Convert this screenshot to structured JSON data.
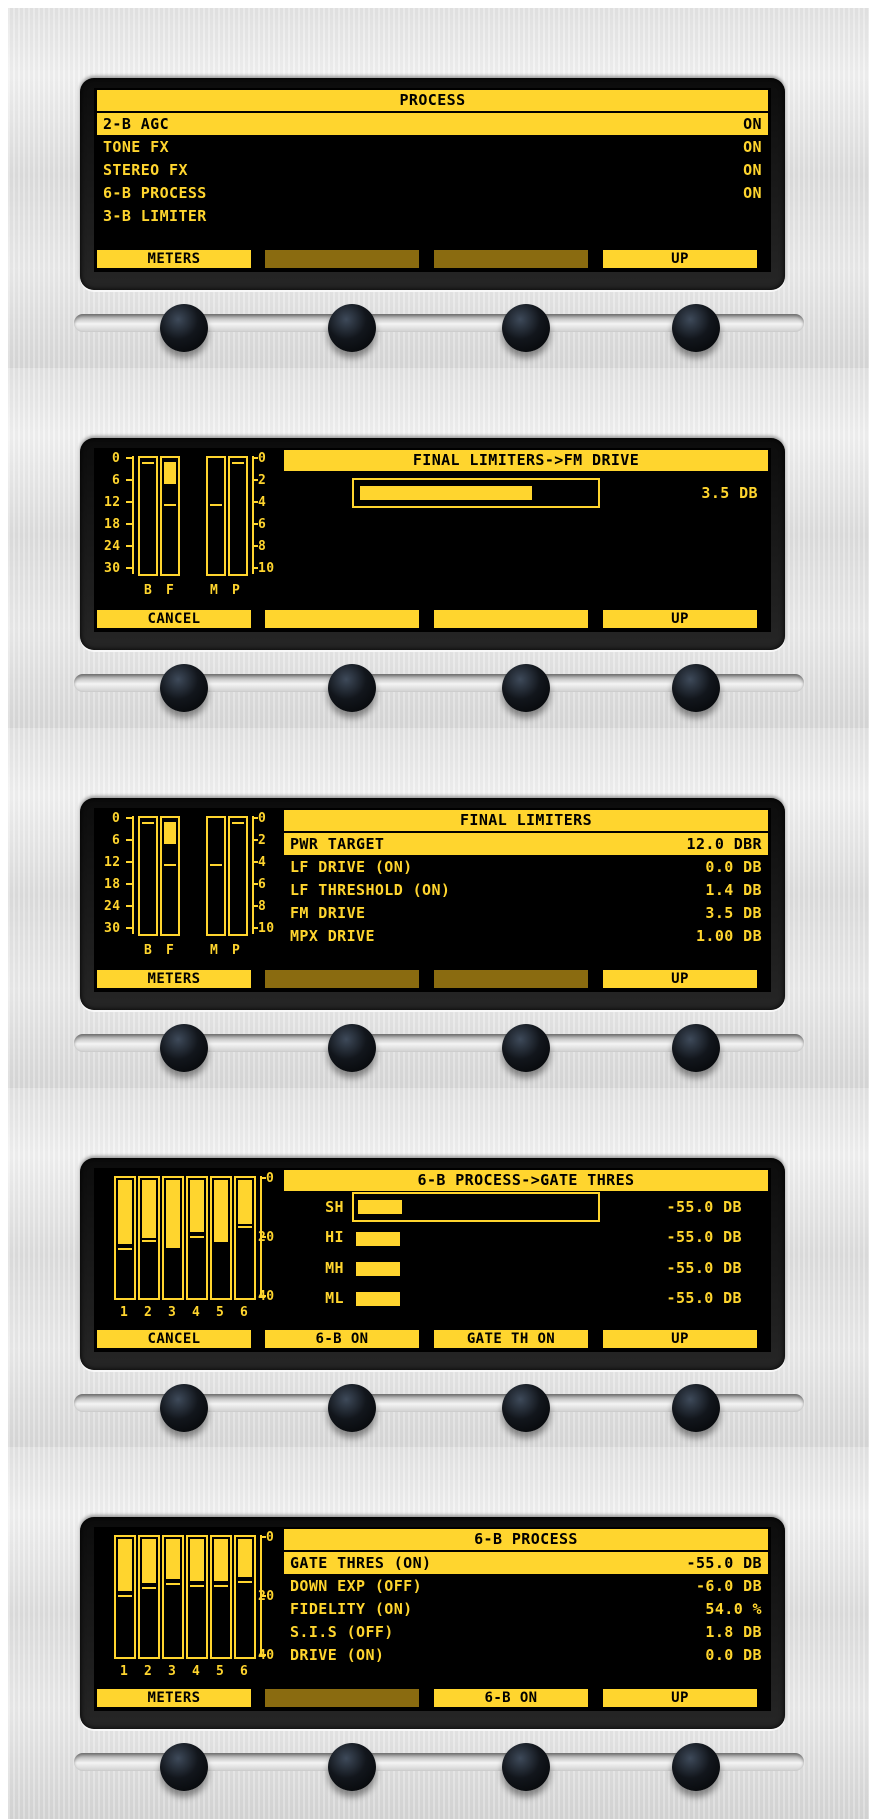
{
  "accent_color": "#ffd52e",
  "dim_key_color": "#8a6b10",
  "panels": [
    {
      "title": "PROCESS",
      "items": [
        {
          "label": "2-B AGC",
          "value": "ON"
        },
        {
          "label": "TONE FX",
          "value": "ON"
        },
        {
          "label": "STEREO FX",
          "value": "ON"
        },
        {
          "label": "6-B PROCESS",
          "value": "ON"
        },
        {
          "label": "3-B LIMITER",
          "value": ""
        }
      ],
      "softkeys": [
        "METERS",
        "",
        "",
        "UP"
      ]
    },
    {
      "title": "FINAL LIMITERS->FM DRIVE",
      "meter_labels": {
        "left_scale": [
          "0",
          "6",
          "12",
          "18",
          "24",
          "30"
        ],
        "right_scale": [
          "0",
          "2",
          "4",
          "6",
          "8",
          "10"
        ],
        "bars": [
          "B",
          "F",
          "M",
          "P"
        ]
      },
      "fm_drive_level": 0.74,
      "value": "3.5 DB",
      "softkeys": [
        "CANCEL",
        "",
        "",
        "UP"
      ]
    },
    {
      "title": "FINAL LIMITERS",
      "meter_labels": {
        "left_scale": [
          "0",
          "6",
          "12",
          "18",
          "24",
          "30"
        ],
        "right_scale": [
          "0",
          "2",
          "4",
          "6",
          "8",
          "10"
        ],
        "bars": [
          "B",
          "F",
          "M",
          "P"
        ]
      },
      "items": [
        {
          "label": "PWR TARGET",
          "value": "12.0 DBR"
        },
        {
          "label": "LF DRIVE (ON)",
          "value": "0.0 DB"
        },
        {
          "label": "LF THRESHOLD (ON)",
          "value": "1.4 DB"
        },
        {
          "label": "FM DRIVE",
          "value": "3.5 DB"
        },
        {
          "label": "MPX DRIVE",
          "value": "1.00 DB"
        }
      ],
      "softkeys": [
        "METERS",
        "",
        "",
        "UP"
      ]
    },
    {
      "title": "6-B PROCESS->GATE THRES",
      "meter_labels": {
        "scale": [
          "0",
          "20",
          "40"
        ],
        "bars": [
          "1",
          "2",
          "3",
          "4",
          "5",
          "6"
        ]
      },
      "bands": [
        {
          "label": "SH",
          "value": "-55.0 DB"
        },
        {
          "label": "HI",
          "value": "-55.0 DB"
        },
        {
          "label": "MH",
          "value": "-55.0 DB"
        },
        {
          "label": "ML",
          "value": "-55.0 DB"
        }
      ],
      "softkeys": [
        "CANCEL",
        "6-B ON",
        "GATE TH ON",
        "UP"
      ]
    },
    {
      "title": "6-B PROCESS",
      "meter_labels": {
        "scale": [
          "0",
          "20",
          "40"
        ],
        "bars": [
          "1",
          "2",
          "3",
          "4",
          "5",
          "6"
        ]
      },
      "items": [
        {
          "label": "GATE THRES (ON)",
          "value": "-55.0 DB"
        },
        {
          "label": "DOWN EXP (OFF)",
          "value": "-6.0 DB"
        },
        {
          "label": "FIDELITY (ON)",
          "value": "54.0 %"
        },
        {
          "label": "S.I.S (OFF)",
          "value": "1.8 DB"
        },
        {
          "label": "DRIVE (ON)",
          "value": "0.0 DB"
        }
      ],
      "softkeys": [
        "METERS",
        "",
        "6-B ON",
        "UP"
      ]
    }
  ]
}
